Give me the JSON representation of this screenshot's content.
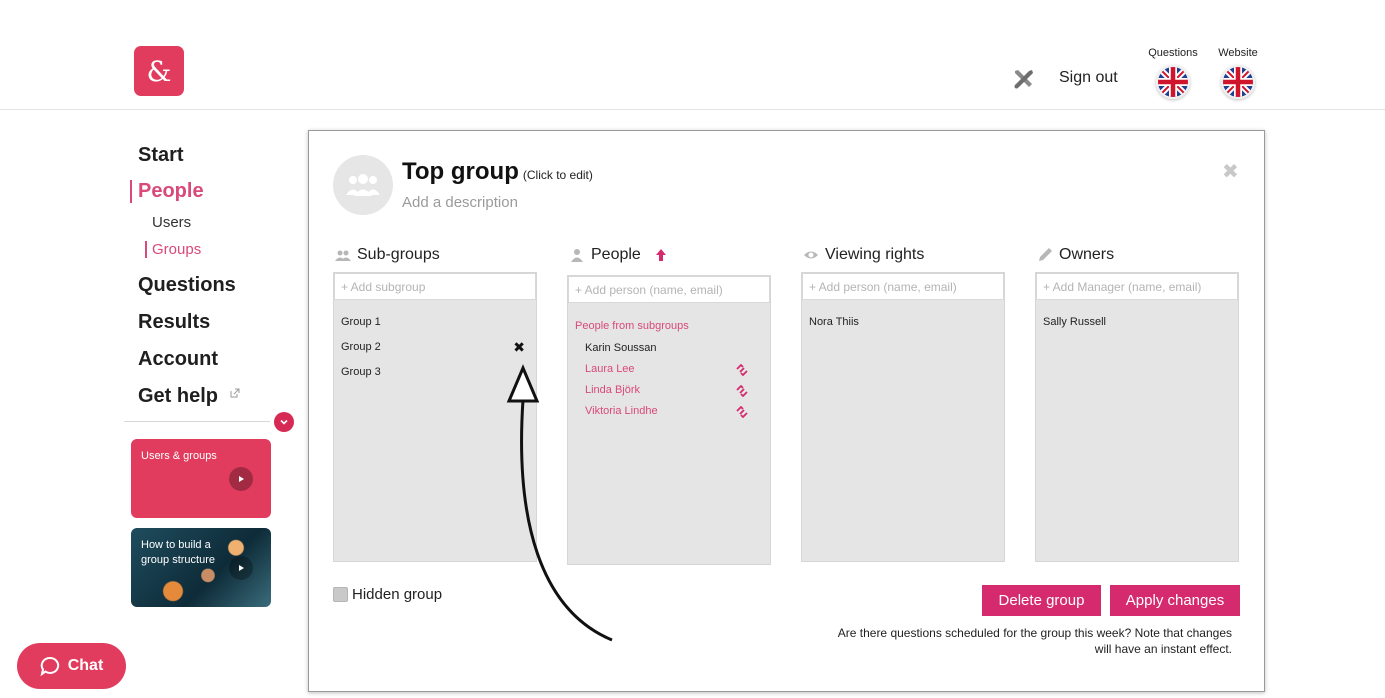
{
  "header": {
    "logo_char": "&",
    "sign_out": "Sign out",
    "lang_questions_label": "Questions",
    "lang_website_label": "Website",
    "flag": "uk-flag-icon"
  },
  "sidebar": {
    "items": [
      {
        "label": "Start"
      },
      {
        "label": "People"
      },
      {
        "label": "Users"
      },
      {
        "label": "Groups"
      },
      {
        "label": "Questions"
      },
      {
        "label": "Results"
      },
      {
        "label": "Account"
      },
      {
        "label": "Get help"
      }
    ],
    "videos": [
      {
        "title": "Users & groups"
      },
      {
        "title": "How to build a group structure"
      }
    ]
  },
  "chat": {
    "label": "Chat"
  },
  "panel": {
    "title": "Top group",
    "title_hint": "(Click to edit)",
    "description_placeholder": "Add a description",
    "subgroups": {
      "heading": "Sub-groups",
      "placeholder": "+ Add subgroup",
      "items": [
        "Group 1",
        "Group 2",
        "Group 3"
      ]
    },
    "people": {
      "heading": "People",
      "placeholder": "+ Add person (name, email)",
      "section_label": "People from subgroups",
      "items": [
        {
          "name": "Karin Soussan"
        },
        {
          "name": "Laura Lee"
        },
        {
          "name": "Linda Björk"
        },
        {
          "name": "Viktoria Lindhe"
        }
      ]
    },
    "viewing_rights": {
      "heading": "Viewing rights",
      "placeholder": "+ Add person (name, email)",
      "items": [
        "Nora Thiis"
      ]
    },
    "owners": {
      "heading": "Owners",
      "placeholder": "+ Add Manager (name, email)",
      "items": [
        "Sally Russell"
      ]
    },
    "hidden_group_label": "Hidden group",
    "delete_button": "Delete group",
    "apply_button": "Apply changes",
    "note": "Are there questions scheduled for the group this week? Note that changes will have an instant effect."
  },
  "colors": {
    "brand": "#e13c5e",
    "accent_pink": "#d9497a",
    "button": "#d62a6f"
  }
}
